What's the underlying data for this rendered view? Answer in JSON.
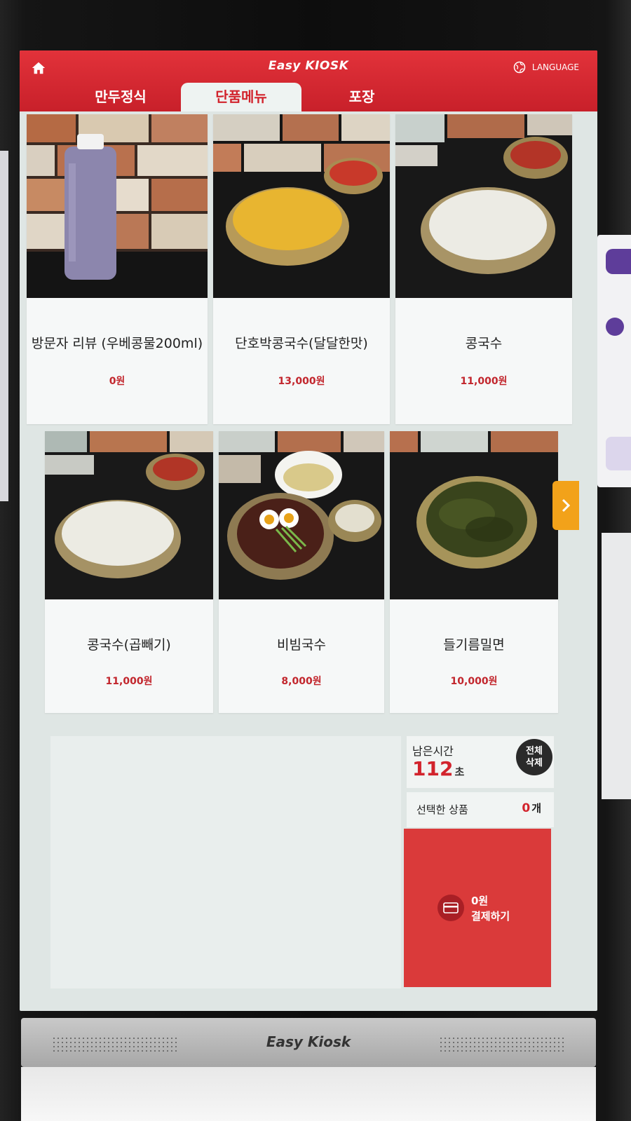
{
  "header": {
    "brand": "Easy KIOSK",
    "language_label": "LANGUAGE",
    "accent_color": "#d2232c"
  },
  "tabs": [
    {
      "label": "만두정식",
      "active": false
    },
    {
      "label": "단품메뉴",
      "active": true
    },
    {
      "label": "포장",
      "active": false
    }
  ],
  "menu_items": [
    {
      "name": "방문자 리뷰 (우베콩물200ml)",
      "price": "0원"
    },
    {
      "name": "단호박콩국수(달달한맛)",
      "price": "13,000원"
    },
    {
      "name": "콩국수",
      "price": "11,000원"
    },
    {
      "name": "콩국수(곱빼기)",
      "price": "11,000원"
    },
    {
      "name": "비빔국수",
      "price": "8,000원"
    },
    {
      "name": "들기름밀면",
      "price": "10,000원"
    }
  ],
  "order_panel": {
    "time_left_label": "남은시간",
    "time_left_value": "112",
    "time_unit": "초",
    "clear_all_label_line1": "전체",
    "clear_all_label_line2": "삭제",
    "selected_label": "선택한 상품",
    "selected_count": "0",
    "selected_unit": "개",
    "pay_amount": "0원",
    "pay_label": "결제하기"
  },
  "device": {
    "bottom_brand": "Easy Kiosk"
  },
  "icons": [
    "home-icon",
    "globe-icon",
    "chevron-right-icon",
    "card-icon"
  ]
}
